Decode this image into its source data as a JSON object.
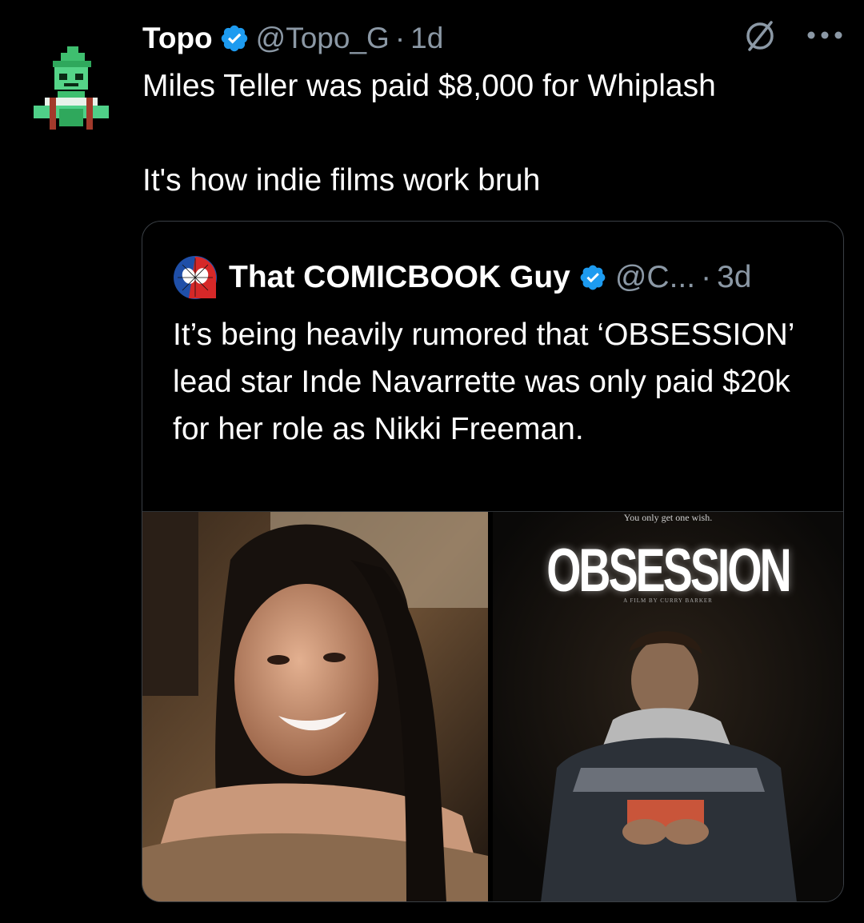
{
  "tweet": {
    "display_name": "Topo",
    "handle": "@Topo_G",
    "separator": "·",
    "time": "1d",
    "text_line1": "Miles Teller was paid $8,000 for Whiplash",
    "text_line2": "It's how indie films work bruh",
    "avatar_icon": "pixel-elf-avatar",
    "verified_icon": "verified-badge-icon",
    "accent_color": "#1d9bf0"
  },
  "quoted_tweet": {
    "display_name": "That COMICBOOK Guy",
    "handle": "@C...",
    "separator": "·",
    "time": "3d",
    "text": "It’s being heavily rumored that ‘OBSESSION’ lead star Inde Navarrette was only paid $20k for her role as Nikki Freeman.",
    "avatar_icon": "spider-man-mask-avatar",
    "poster": {
      "tagline": "You only get one wish.",
      "title": "OBSESSION",
      "credit": "A FILM BY CURRY BARKER"
    }
  }
}
